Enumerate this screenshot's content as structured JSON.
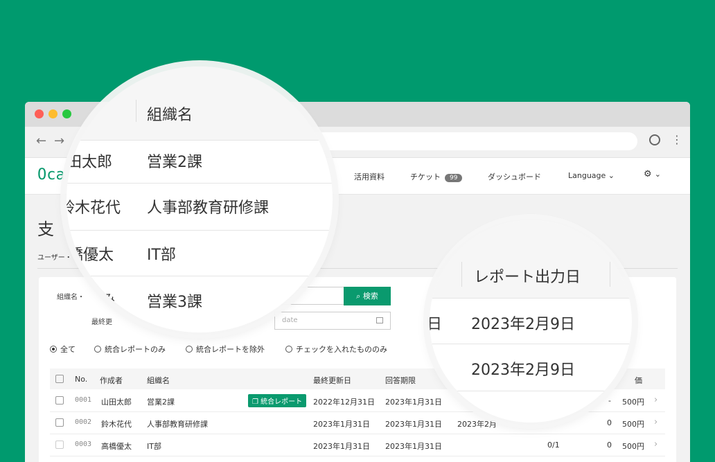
{
  "header": {
    "logo": "Oca",
    "nav": {
      "materials": "活用資料",
      "tickets": "チケット",
      "ticket_count": "99",
      "dashboard": "ダッシュボード",
      "language": "Language ⌄",
      "settings_caret": "⌄"
    }
  },
  "page": {
    "title_partial": "支",
    "subtitle_partial": "ユーザー・"
  },
  "filters": {
    "org_label_partial": "組織名・",
    "last_updated_label_partial": "最終更",
    "search_button": "検索",
    "date_placeholder": "date",
    "radios": [
      "全て",
      "統合レポートのみ",
      "統合レポートを除外",
      "チェックを入れたもののみ"
    ]
  },
  "table": {
    "headers": {
      "no": "No.",
      "author": "作成者",
      "org": "組織名",
      "updated": "最終更新日",
      "deadline": "回答期限",
      "price_partial": "価"
    },
    "rows": [
      {
        "no": "0001",
        "author": "山田太郎",
        "org": "営業2課",
        "tag": "統合レポート",
        "updated": "2022年12月31日",
        "deadline": "2023年1月31日",
        "report": "",
        "count": "",
        "num": "-",
        "price": "500円"
      },
      {
        "no": "0002",
        "author": "鈴木花代",
        "org": "人事部教育研修課",
        "tag": "",
        "updated": "2023年1月31日",
        "deadline": "2023年1月31日",
        "report": "2023年2月",
        "count": "",
        "num": "0",
        "price": "500円"
      },
      {
        "no": "0003",
        "author": "高橋優太",
        "org": "IT部",
        "tag": "",
        "updated": "2023年1月31日",
        "deadline": "2023年1月31日",
        "report": "",
        "count": "0/1",
        "num": "0",
        "price": "500円"
      }
    ]
  },
  "zoom_left": {
    "header": "組織名",
    "rows": [
      {
        "name": "田太郎",
        "org": "営業2課"
      },
      {
        "name": "鈴木花代",
        "org": "人事部教育研修課"
      },
      {
        "name": "橋優太",
        "org": "IT部"
      },
      {
        "name": "み",
        "org": "営業3課"
      }
    ]
  },
  "zoom_right": {
    "header": "レポート出力日",
    "left_fragment": "日",
    "rows": [
      "2023年2月9日",
      "2023年2月9日"
    ]
  }
}
